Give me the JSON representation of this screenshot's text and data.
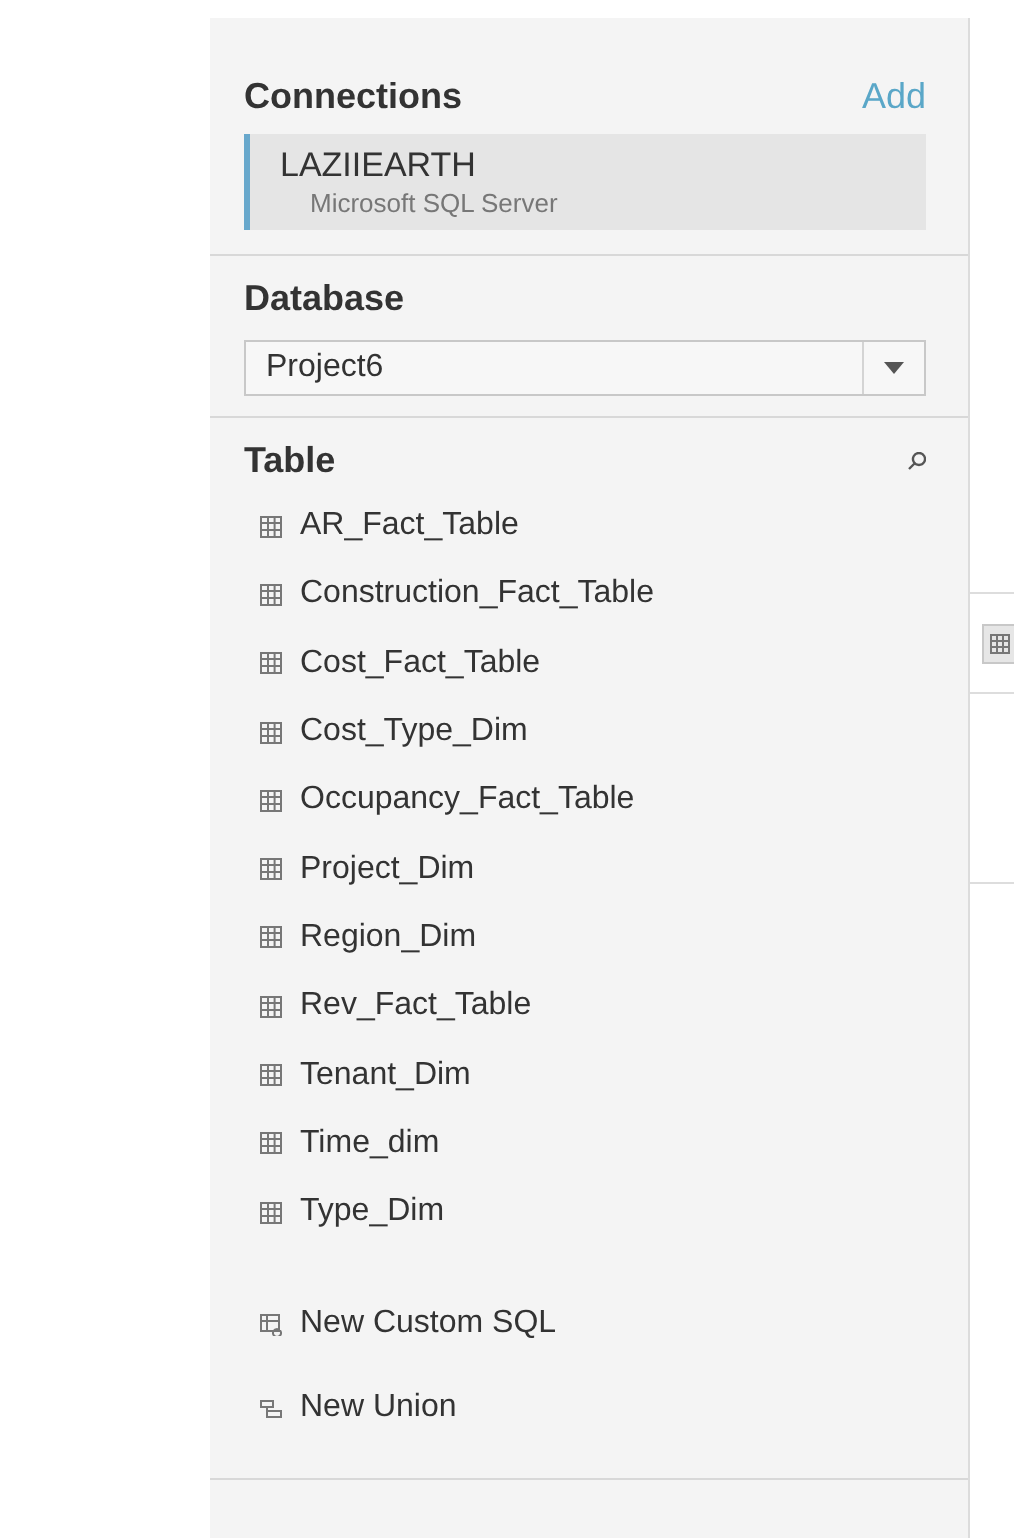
{
  "connections": {
    "title": "Connections",
    "add_link": "Add",
    "items": [
      {
        "name": "LAZIIEARTH",
        "type": "Microsoft SQL Server",
        "selected": true
      }
    ]
  },
  "database": {
    "title": "Database",
    "value": "Project6"
  },
  "table": {
    "title": "Table",
    "items": [
      {
        "name": "AR_Fact_Table",
        "kind": "table"
      },
      {
        "name": "Construction_Fact_Table",
        "kind": "table"
      },
      {
        "name": "Cost_Fact_Table",
        "kind": "table"
      },
      {
        "name": "Cost_Type_Dim",
        "kind": "table"
      },
      {
        "name": "Occupancy_Fact_Table",
        "kind": "table"
      },
      {
        "name": "Project_Dim",
        "kind": "table"
      },
      {
        "name": "Region_Dim",
        "kind": "table"
      },
      {
        "name": "Rev_Fact_Table",
        "kind": "table"
      },
      {
        "name": "Tenant_Dim",
        "kind": "table"
      },
      {
        "name": "Time_dim",
        "kind": "table"
      },
      {
        "name": "Type_Dim",
        "kind": "table"
      }
    ],
    "actions": [
      {
        "label": "New Custom SQL",
        "kind": "custom-sql"
      },
      {
        "label": "New Union",
        "kind": "union"
      }
    ]
  }
}
